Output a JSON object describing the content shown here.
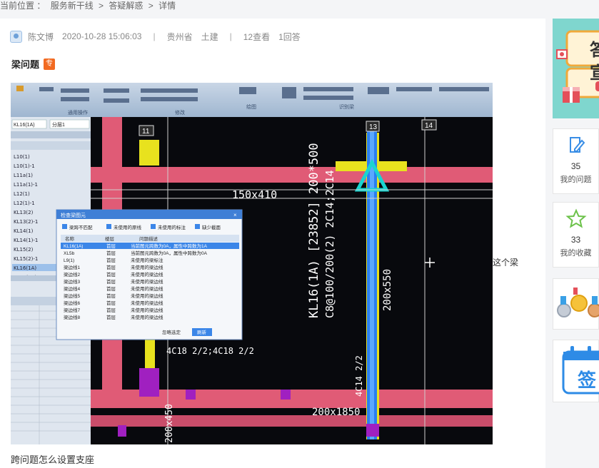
{
  "breadcrumb": {
    "prefix": "当前位置 ：",
    "items": [
      "服务新干线",
      ">",
      "答疑解惑",
      ">",
      "详情"
    ]
  },
  "question": {
    "author": "陈文博",
    "datetime": "2020-10-28 15:06:03",
    "separator": "|",
    "region": "贵州省",
    "category": "土建",
    "views": "12查看",
    "answers": "1回答",
    "title": "梁问题",
    "tag": "专",
    "side_caption": "这个梁",
    "body_caption": "跨问题怎么设置支座"
  },
  "screenshot_content": {
    "dialog_title": "检查梁图元",
    "dialog_checks": [
      "梁跨不匹配",
      "未使用的原线",
      "未使用的标注",
      "缺少截面"
    ],
    "dialog_headers": [
      "名称",
      "楼层",
      "问题描述"
    ],
    "dialog_rows": [
      [
        "KL16(1A)",
        "首层",
        "当前图元跨数为0A，属性中跨数为1A"
      ],
      [
        "XL5b",
        "首层",
        "当前图元跨数为0A，属性中跨数为0A"
      ],
      [
        "L9(1)",
        "首层",
        "未使用的梁标注"
      ],
      [
        "梁边线1",
        "首层",
        "未使用的梁边线"
      ],
      [
        "梁边线2",
        "首层",
        "未使用的梁边线"
      ],
      [
        "梁边线3",
        "首层",
        "未使用的梁边线"
      ],
      [
        "梁边线4",
        "首层",
        "未使用的梁边线"
      ],
      [
        "梁边线5",
        "首层",
        "未使用的梁边线"
      ],
      [
        "梁边线6",
        "首层",
        "未使用的梁边线"
      ],
      [
        "梁边线7",
        "首层",
        "未使用的梁边线"
      ],
      [
        "梁边线8",
        "首层",
        "未使用的梁边线"
      ]
    ],
    "dialog_btn_ok": "刷新",
    "dialog_btn_more": "忽略选定",
    "beam_label_1": "KL16(1A) [23852] 200*500",
    "beam_label_2": "C8@100/200(2) 2C14;2C14",
    "dim_1": "150x410",
    "dim_2": "200x550",
    "dim_3": "200x1850",
    "dim_4": "200x450",
    "dim_5": "4C18 2/2;4C18 2/2",
    "dim_6": "4C14 2/2",
    "grid_11": "11",
    "grid_13": "13",
    "grid_14": "14",
    "sel_combo": "KL16(1A)",
    "floor_combo": "分层1",
    "left_list": [
      "L10(1)",
      "L10(1)-1",
      "L11a(1)",
      "L11a(1)-1",
      "L12(1)",
      "L12(1)-1",
      "KL13(2)",
      "KL13(2)-1",
      "KL14(1)",
      "KL14(1)-1",
      "KL15(2)",
      "KL15(2)-1",
      "KL16(1A)",
      "KL16(1A)-1"
    ],
    "ribbon_labels": [
      "通用操作",
      "修改",
      "绘图",
      "识别梁"
    ]
  },
  "sidebar": {
    "questions_count": "35",
    "questions_label": "我的问题",
    "favorites_count": "33",
    "favorites_label": "我的收藏",
    "signin_char": "签",
    "banner_chars": [
      "答",
      "宣"
    ]
  },
  "colors": {
    "accent": "#2e8be6",
    "tag": "#f26a21",
    "banner": "#7fd6ce"
  }
}
